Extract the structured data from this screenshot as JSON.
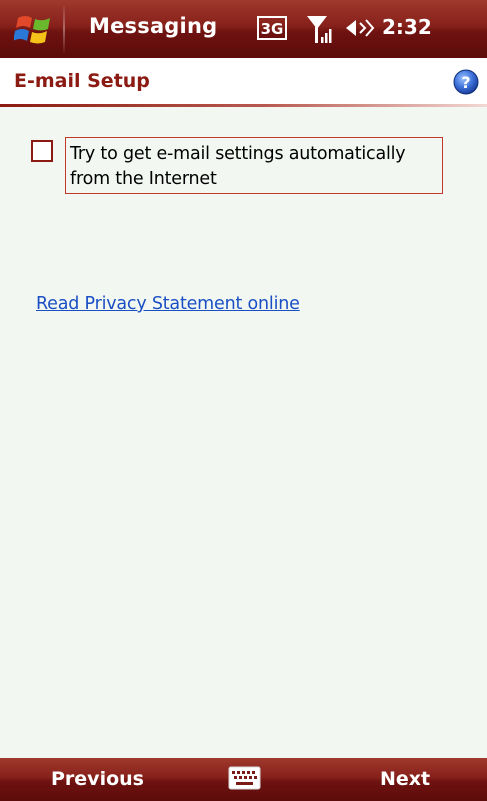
{
  "status_bar": {
    "app_title": "Messaging",
    "network_label": "3G",
    "time": "2:32",
    "icons": [
      "windows-start-icon",
      "3g-network-icon",
      "signal-strength-icon",
      "volume-icon"
    ]
  },
  "page": {
    "title": "E-mail Setup",
    "help_icon": "help-icon"
  },
  "content": {
    "auto_settings_checkbox": {
      "label": "Try to get e-mail settings automatically from the Internet",
      "checked": false
    },
    "privacy_link": "Read Privacy Statement online"
  },
  "softkeys": {
    "left": "Previous",
    "center_icon": "keyboard-icon",
    "right": "Next"
  },
  "colors": {
    "bar_red": "#86201a",
    "accent_red": "#8b1a12",
    "link_blue": "#1a4fc4",
    "background": "#f2f7f2"
  }
}
